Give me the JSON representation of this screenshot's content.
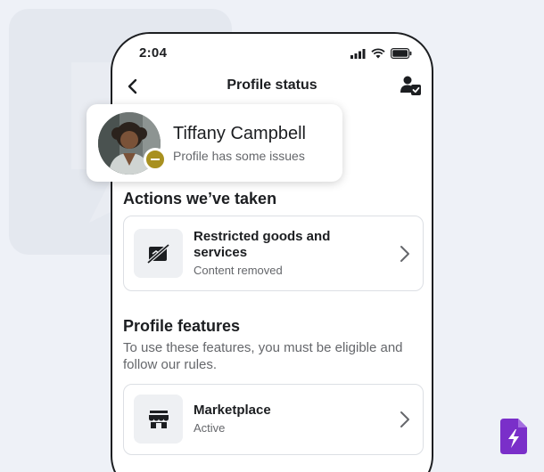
{
  "status_bar": {
    "time": "2:04"
  },
  "header": {
    "title": "Profile status"
  },
  "profile": {
    "name": "Tiffany Campbell",
    "status": "Profile has some issues",
    "status_color": "#a8901f"
  },
  "actions": {
    "title": "Actions we’ve taken",
    "items": [
      {
        "title": "Restricted goods and services",
        "subtitle": "Content removed",
        "icon": "restricted-goods-icon"
      }
    ]
  },
  "features": {
    "title": "Profile features",
    "description": "To use these features, you must be eligible and follow our rules.",
    "items": [
      {
        "title": "Marketplace",
        "subtitle": "Active",
        "icon": "storefront-icon"
      }
    ]
  },
  "colors": {
    "background": "#eef1f7",
    "accent": "#7a2fc9",
    "warning": "#a8901f"
  }
}
